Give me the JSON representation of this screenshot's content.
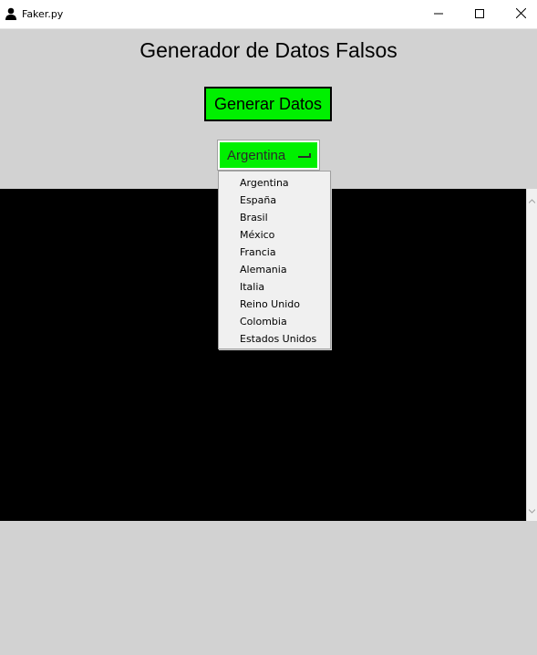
{
  "window": {
    "title": "Faker.py",
    "minimize_icon": "minimize-icon",
    "maximize_icon": "maximize-icon",
    "close_icon": "close-icon"
  },
  "main": {
    "heading": "Generador de Datos Falsos",
    "generate_button_label": "Generar Datos",
    "country_select": {
      "selected": "Argentina",
      "options": [
        "Argentina",
        "España",
        "Brasil",
        "México",
        "Francia",
        "Alemania",
        "Italia",
        "Reino Unido",
        "Colombia",
        "Estados Unidos"
      ]
    }
  },
  "colors": {
    "accent_green": "#00f000",
    "background": "#d2d2d2",
    "output_background": "#000000"
  }
}
